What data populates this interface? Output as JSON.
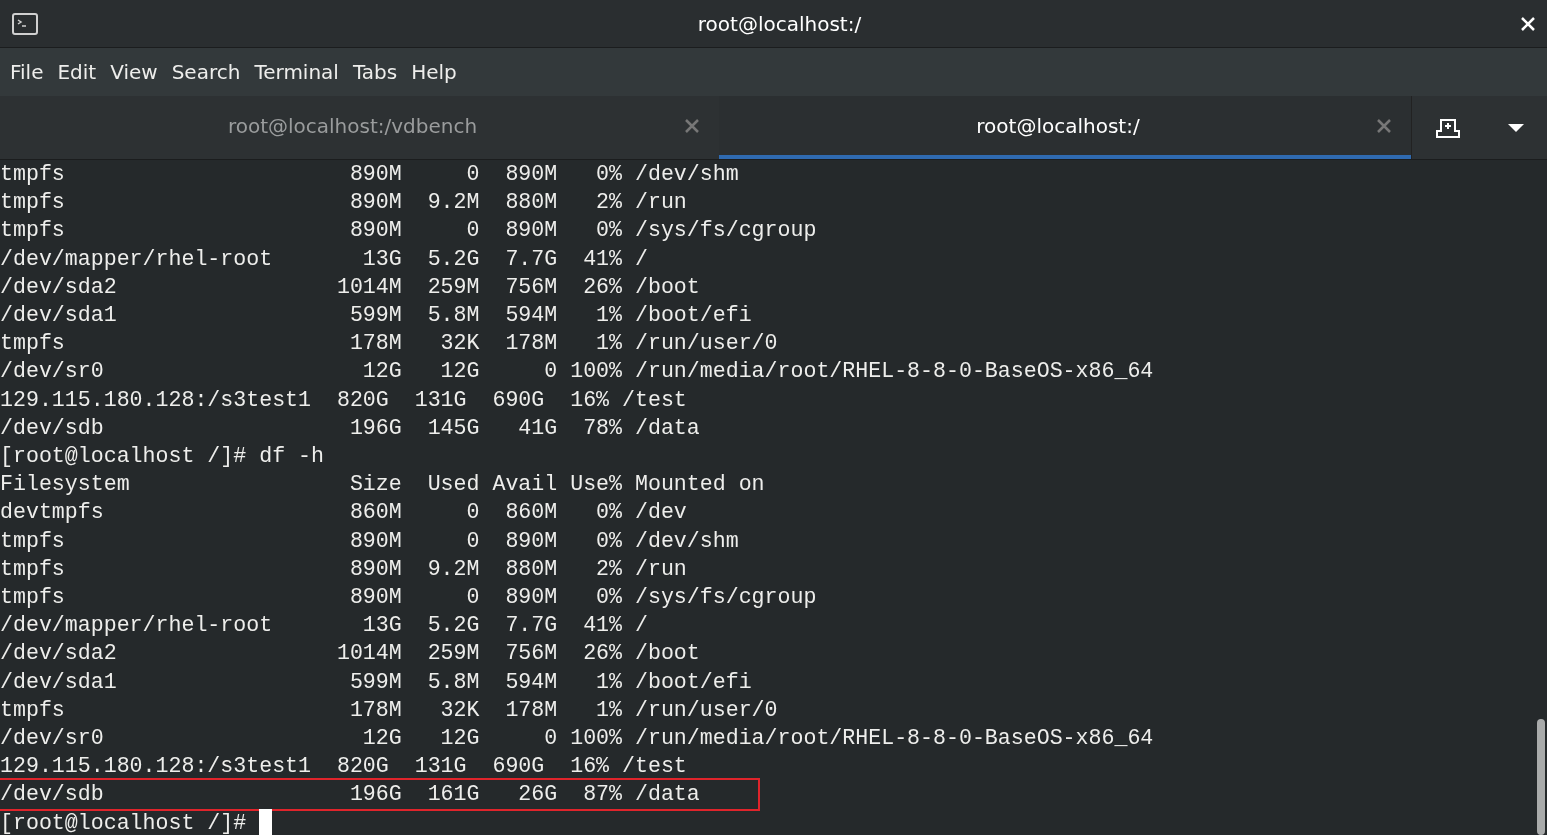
{
  "window": {
    "title": "root@localhost:/"
  },
  "menu": [
    "File",
    "Edit",
    "View",
    "Search",
    "Terminal",
    "Tabs",
    "Help"
  ],
  "tabs": [
    {
      "label": "root@localhost:/vdbench",
      "selected": false
    },
    {
      "label": "root@localhost:/",
      "selected": true
    }
  ],
  "terminal": {
    "lines": [
      {
        "text": "tmpfs                      890M     0  890M   0% /dev/shm",
        "highlighted": false
      },
      {
        "text": "tmpfs                      890M  9.2M  880M   2% /run",
        "highlighted": false
      },
      {
        "text": "tmpfs                      890M     0  890M   0% /sys/fs/cgroup",
        "highlighted": false
      },
      {
        "text": "/dev/mapper/rhel-root       13G  5.2G  7.7G  41% /",
        "highlighted": false
      },
      {
        "text": "/dev/sda2                 1014M  259M  756M  26% /boot",
        "highlighted": false
      },
      {
        "text": "/dev/sda1                  599M  5.8M  594M   1% /boot/efi",
        "highlighted": false
      },
      {
        "text": "tmpfs                      178M   32K  178M   1% /run/user/0",
        "highlighted": false
      },
      {
        "text": "/dev/sr0                    12G   12G     0 100% /run/media/root/RHEL-8-8-0-BaseOS-x86_64",
        "highlighted": false
      },
      {
        "text": "129.115.180.128:/s3test1  820G  131G  690G  16% /test",
        "highlighted": false
      },
      {
        "text": "/dev/sdb                   196G  145G   41G  78% /data",
        "highlighted": false
      },
      {
        "text": "[root@localhost /]# df -h",
        "highlighted": false
      },
      {
        "text": "Filesystem                 Size  Used Avail Use% Mounted on",
        "highlighted": false
      },
      {
        "text": "devtmpfs                   860M     0  860M   0% /dev",
        "highlighted": false
      },
      {
        "text": "tmpfs                      890M     0  890M   0% /dev/shm",
        "highlighted": false
      },
      {
        "text": "tmpfs                      890M  9.2M  880M   2% /run",
        "highlighted": false
      },
      {
        "text": "tmpfs                      890M     0  890M   0% /sys/fs/cgroup",
        "highlighted": false
      },
      {
        "text": "/dev/mapper/rhel-root       13G  5.2G  7.7G  41% /",
        "highlighted": false
      },
      {
        "text": "/dev/sda2                 1014M  259M  756M  26% /boot",
        "highlighted": false
      },
      {
        "text": "/dev/sda1                  599M  5.8M  594M   1% /boot/efi",
        "highlighted": false
      },
      {
        "text": "tmpfs                      178M   32K  178M   1% /run/user/0",
        "highlighted": false
      },
      {
        "text": "/dev/sr0                    12G   12G     0 100% /run/media/root/RHEL-8-8-0-BaseOS-x86_64",
        "highlighted": false
      },
      {
        "text": "129.115.180.128:/s3test1  820G  131G  690G  16% /test",
        "highlighted": false
      },
      {
        "text": "/dev/sdb                   196G  161G   26G  87% /data",
        "highlighted": true
      }
    ],
    "prompt": "[root@localhost /]# ",
    "cursor": true
  }
}
